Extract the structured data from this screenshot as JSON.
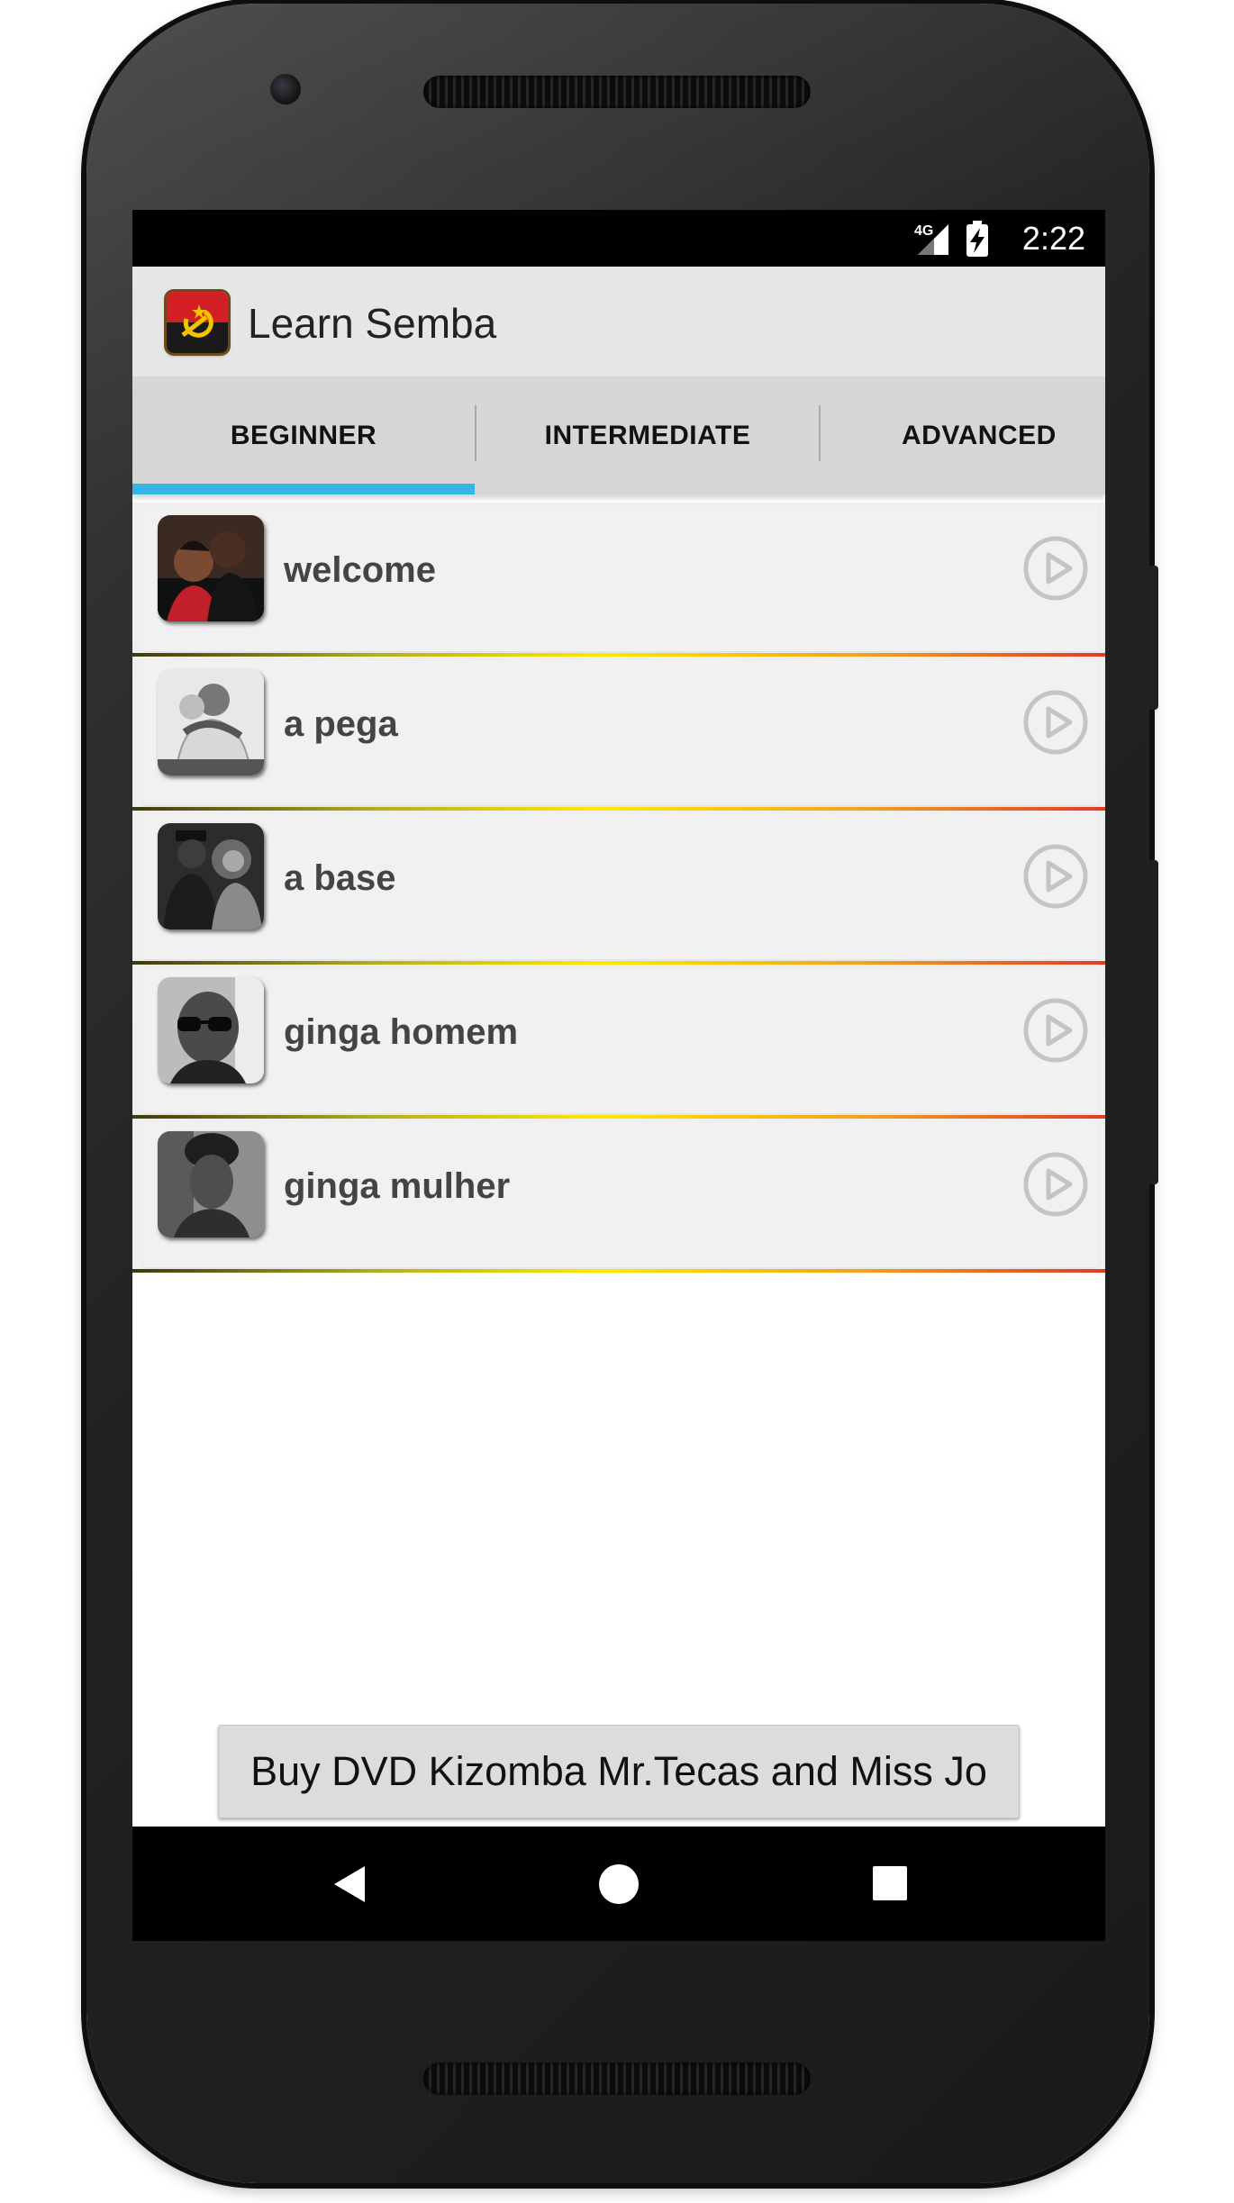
{
  "status_bar": {
    "network": "4G",
    "time": "2:22"
  },
  "app_bar": {
    "title": "Learn Semba",
    "logo_icon": "angola-flag-icon"
  },
  "tabs": [
    {
      "label": "BEGINNER",
      "selected": true
    },
    {
      "label": "INTERMEDIATE",
      "selected": false
    },
    {
      "label": "ADVANCED",
      "selected": false
    }
  ],
  "lessons": [
    {
      "title": "welcome",
      "thumbnail": "couple-photo-color",
      "action_icon": "play-circle-icon"
    },
    {
      "title": "a pega",
      "thumbnail": "couple-embrace-photo",
      "action_icon": "play-circle-icon"
    },
    {
      "title": "a base",
      "thumbnail": "couple-dance-photo",
      "action_icon": "play-circle-icon"
    },
    {
      "title": "ginga homem",
      "thumbnail": "man-sunglasses-photo",
      "action_icon": "play-circle-icon"
    },
    {
      "title": "ginga mulher",
      "thumbnail": "woman-portrait-photo",
      "action_icon": "play-circle-icon"
    }
  ],
  "footer": {
    "buy_button": "Buy DVD Kizomba Mr.Tecas and Miss Jo"
  },
  "nav_bar": {
    "back_icon": "back-triangle-icon",
    "home_icon": "home-circle-icon",
    "recents_icon": "recents-square-icon"
  },
  "colors": {
    "tab_indicator": "#33b5e5",
    "divider_start": "#3c3a10",
    "divider_mid": "#ffe900",
    "divider_end": "#e23b25"
  }
}
